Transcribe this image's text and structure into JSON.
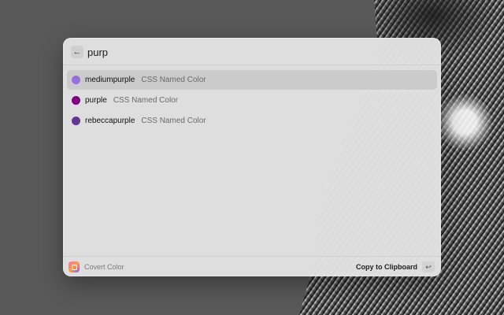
{
  "search": {
    "back_icon": "←",
    "query": "purp"
  },
  "results": [
    {
      "title": "mediumpurple",
      "subtitle": "CSS Named Color",
      "color": "#9370DB",
      "selected": true
    },
    {
      "title": "purple",
      "subtitle": "CSS Named Color",
      "color": "#800080",
      "selected": false
    },
    {
      "title": "rebeccapurple",
      "subtitle": "CSS Named Color",
      "color": "#663399",
      "selected": false
    }
  ],
  "footer": {
    "extension_name": "Covert Color",
    "extension_icon": "palette-icon",
    "primary_action": "Copy to Clipboard",
    "enter_key": "↩"
  }
}
